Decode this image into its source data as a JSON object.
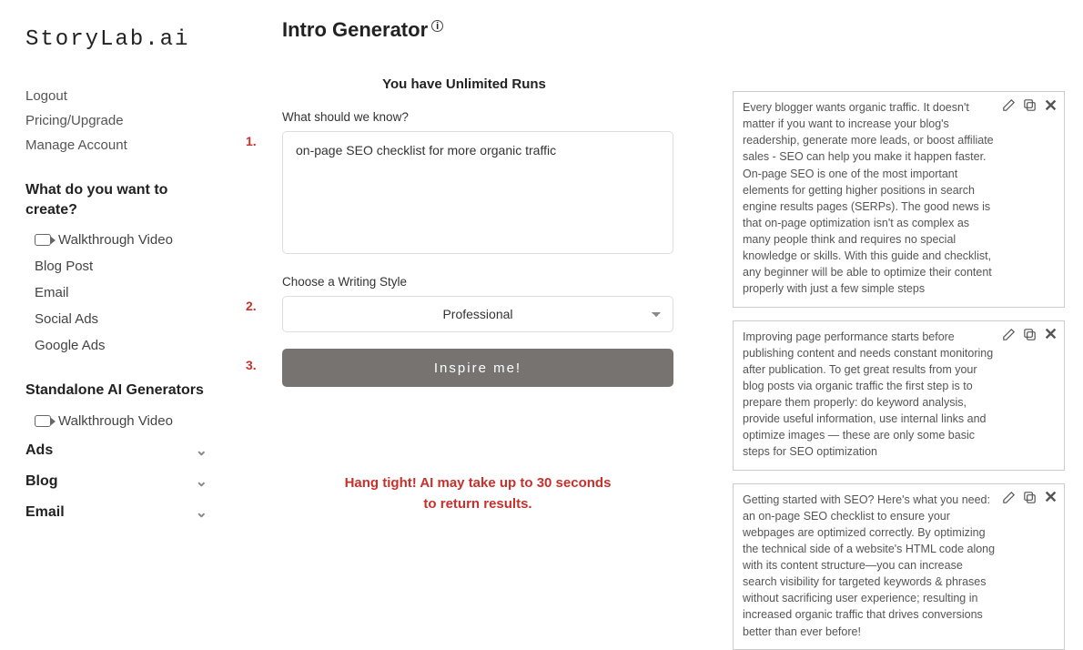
{
  "brand": "StoryLab.ai",
  "sidebar": {
    "links": [
      "Logout",
      "Pricing/Upgrade",
      "Manage Account"
    ],
    "header1": "What do you want to create?",
    "walkthrough1": "Walkthrough Video",
    "create_items": [
      "Blog Post",
      "Email",
      "Social Ads",
      "Google Ads"
    ],
    "header2": "Standalone AI Generators",
    "walkthrough2": "Walkthrough Video",
    "categories": [
      "Ads",
      "Blog",
      "Email"
    ]
  },
  "page": {
    "title": "Intro Generator",
    "runs_msg": "You have Unlimited Runs",
    "steps": [
      "1.",
      "2.",
      "3."
    ],
    "input_label": "What should we know?",
    "input_value": "on-page SEO checklist for more organic traffic",
    "style_label": "Choose a Writing Style",
    "style_selected": "Professional",
    "button_label": "Inspire me!",
    "loading_line1": "Hang tight! AI may take up to 30 seconds",
    "loading_line2": "to return results."
  },
  "results": [
    "Every blogger wants organic traffic. It doesn't matter if you want to increase your blog's readership, generate more leads, or boost affiliate sales - SEO can help you make it happen faster. On-page SEO is one of the most important elements for getting higher positions in search engine results pages (SERPs). The good news is that on-page optimization isn't as complex as many people think and requires no special knowledge or skills. With this guide and checklist, any beginner will be able to optimize their content properly with just a few simple steps",
    "Improving page performance starts before publishing content and needs constant monitoring after publication. To get great results from your blog posts via organic traffic the first step is to prepare them properly: do keyword analysis, provide useful information, use internal links and optimize images — these are only some basic steps for SEO optimization",
    "Getting started with SEO? Here's what you need: an on-page SEO checklist to ensure your webpages are optimized correctly. By optimizing the technical side of a website's HTML code along with its content structure—you can increase search visibility for targeted keywords & phrases without sacrificing user experience; resulting in increased organic traffic that drives conversions better than ever before!"
  ]
}
